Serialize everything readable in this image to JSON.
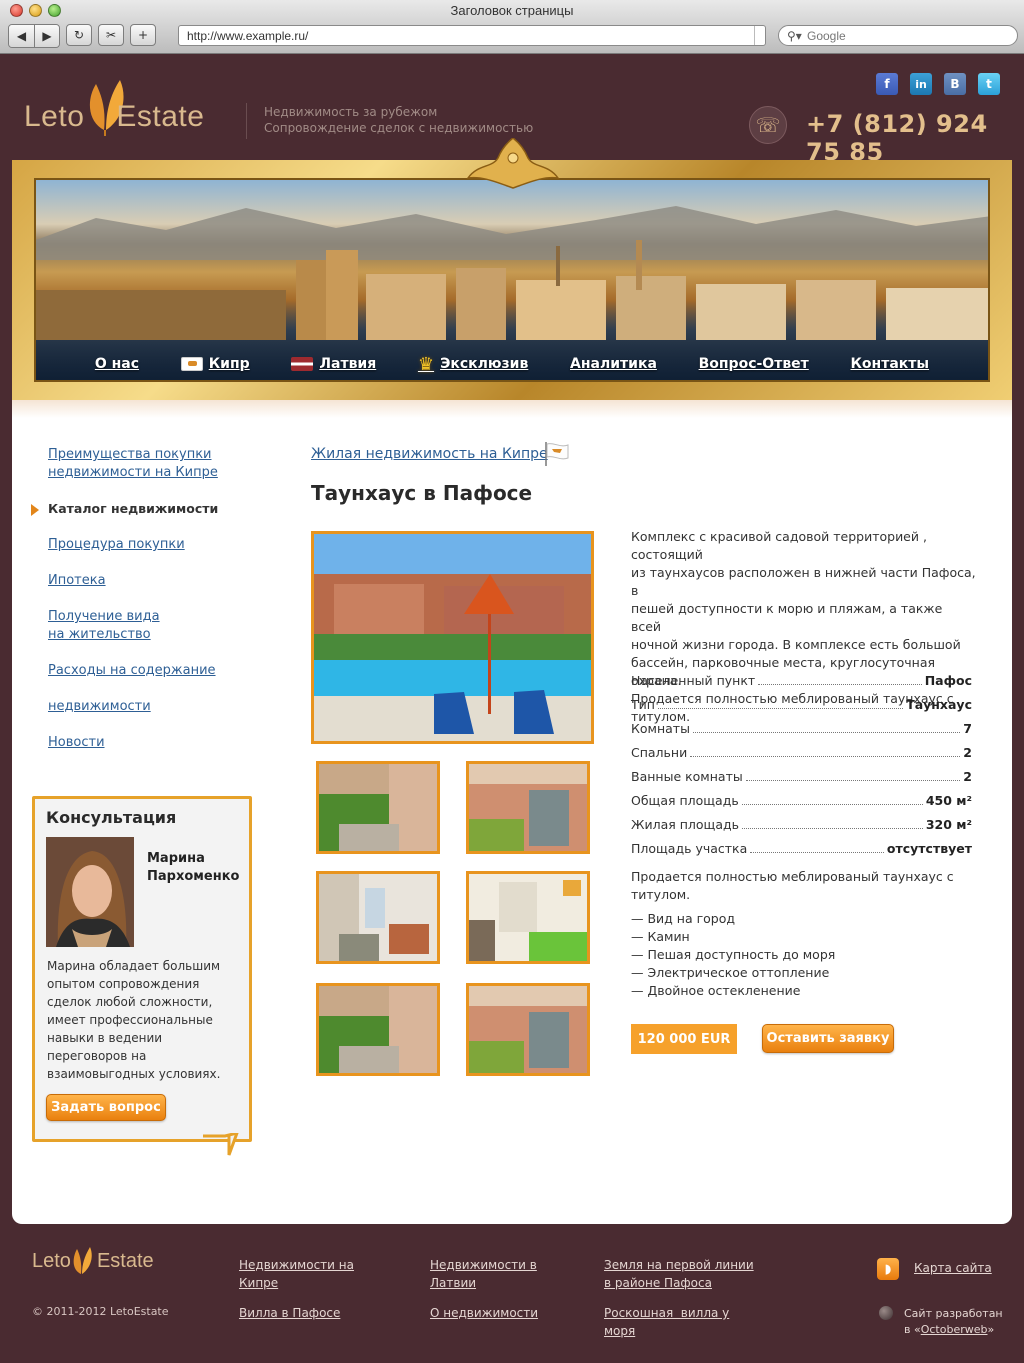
{
  "browser": {
    "window_title": "Заголовок страницы",
    "url": "http://www.example.ru/",
    "search_placeholder": "Google"
  },
  "header": {
    "logo_left": "Leto",
    "logo_right": "Estate",
    "tagline_1": "Недвижимость за рубежом",
    "tagline_2": "Сопровождение сделок с недвижимостью",
    "phone": "+7 (812) 924 75 85",
    "social": [
      "facebook-icon",
      "linkedin-icon",
      "vkontakte-icon",
      "twitter-icon"
    ]
  },
  "nav": {
    "items": [
      {
        "label": "О нас",
        "icon": ""
      },
      {
        "label": "Кипр",
        "icon": "cyprus-flag-icon"
      },
      {
        "label": "Латвия",
        "icon": "latvia-flag-icon"
      },
      {
        "label": "Эксклюзив",
        "icon": "crown-icon"
      },
      {
        "label": "Аналитика",
        "icon": ""
      },
      {
        "label": "Вопрос-Ответ",
        "icon": ""
      },
      {
        "label": "Контакты",
        "icon": ""
      }
    ]
  },
  "sidebar": {
    "items": [
      {
        "label_1": "Преимущества покупки",
        "label_2": "недвижимости на Кипре"
      },
      {
        "label_1": "Каталог недвижимости",
        "active": true
      },
      {
        "label_1": "Процедура покупки"
      },
      {
        "label_1": "Ипотека"
      },
      {
        "label_1": "Получение вида",
        "label_2": "на жительство"
      },
      {
        "label_1": "Расходы на содержание"
      },
      {
        "label_1": "недвижимости"
      },
      {
        "label_1": "Новости"
      }
    ]
  },
  "consult": {
    "title": "Консультация",
    "name_1": "Марина",
    "name_2": "Пархоменко",
    "text": [
      "Марина обладает большим",
      "опытом сопровождения",
      "сделок любой сложности,",
      "имеет профессиональные",
      "навыки в ведении",
      "переговоров на",
      "взаимовыгодных условиях."
    ],
    "button": "Задать вопрос"
  },
  "main": {
    "breadcrumb": "Жилая недвижимость на Кипре",
    "title": "Таунхаус в Пафосе",
    "description": [
      "Комплекс с красивой садовой территорией , состоящий",
      "из таунхаусов расположен в нижней части Пафоса, в",
      "пешей доступности к морю и пляжам, а также всей",
      "ночной жизни города. В комплексе есть большой",
      "бассейн, парковочные места, круглосуточная охрана.",
      "Продается полностью меблированый таунхаус с",
      "титулом."
    ],
    "specs": [
      {
        "label": "Населенный пункт",
        "value": "Пафос"
      },
      {
        "label": "Тип",
        "value": "Таунхаус"
      },
      {
        "label": "Комнаты",
        "value": "7"
      },
      {
        "label": "Спальни",
        "value": "2"
      },
      {
        "label": "Ванные комнаты",
        "value": "2"
      },
      {
        "label": "Общая площадь",
        "value": "450 м²"
      },
      {
        "label": "Жилая площадь",
        "value": "320 м²"
      },
      {
        "label": "Площадь участка",
        "value": "отсутствует"
      }
    ],
    "note": [
      "Продается полностью меблированый таунхаус с",
      "титулом."
    ],
    "features": [
      "— Вид на город",
      "— Камин",
      "— Пешая доступность до моря",
      "— Электрическое оттопление",
      "— Двойное остекленение"
    ],
    "price": "120 000 EUR",
    "cta": "Оставить заявку"
  },
  "footer": {
    "logo_left": "Leto",
    "logo_right": "Estate",
    "copyright": "© 2011-2012 LetoEstate",
    "links": [
      {
        "l1": "Недвижимости на",
        "l2": "Кипре"
      },
      {
        "l1": "Вилла в Пафосе"
      },
      {
        "l1": "Недвижимости в",
        "l2": "Латвии"
      },
      {
        "l1": "О недвижимости"
      },
      {
        "l1": "Земля на первой линии",
        "l2": "в районе Пафоса"
      },
      {
        "l1": "Роскошная  вилла у",
        "l2": "моря"
      }
    ],
    "sitemap": "Карта сайта",
    "dev_1": "Сайт разработан",
    "dev_2_prefix": "в «",
    "dev_2_link": "Octoberweb",
    "dev_2_suffix": "»"
  },
  "colors": {
    "background": "#4a2b31",
    "accent": "#e8941e",
    "link": "#2e5f95",
    "phone": "#e3bf8c"
  }
}
